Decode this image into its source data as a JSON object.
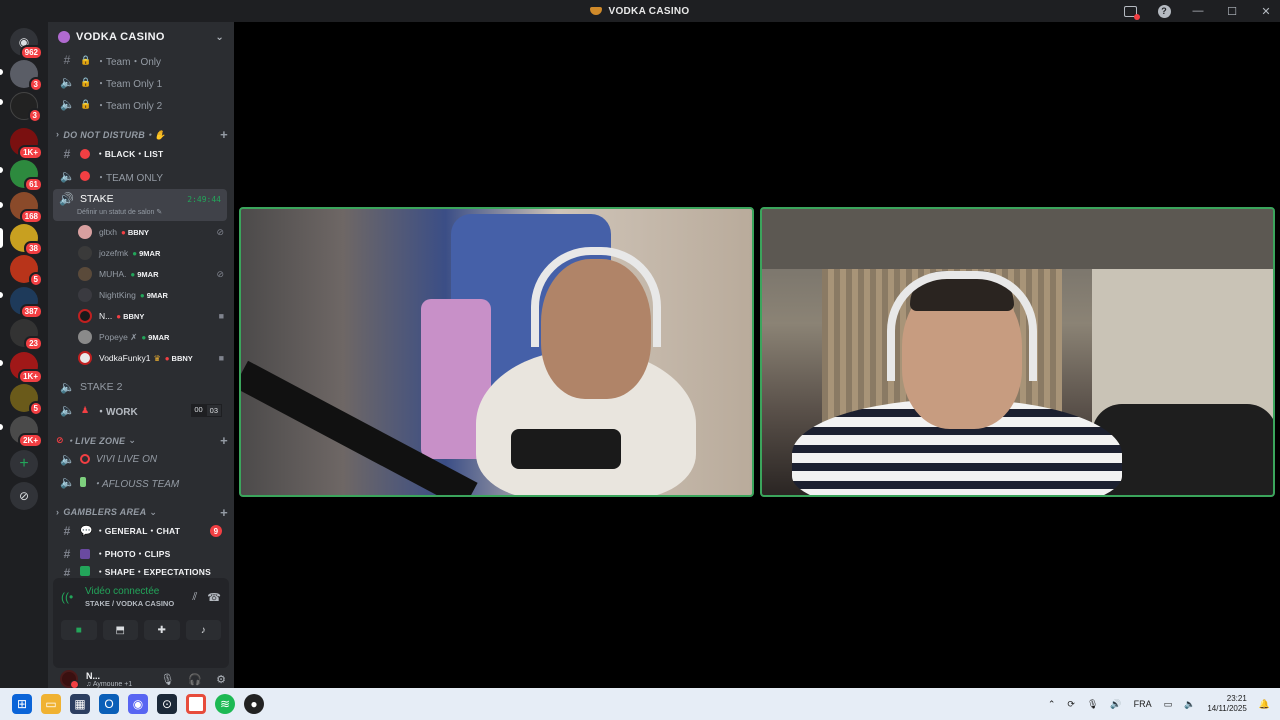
{
  "window": {
    "title": "VODKA CASINO"
  },
  "rail": {
    "badges": [
      "962",
      "3",
      "3",
      "1K+",
      "61",
      "168",
      "38",
      "5",
      "387",
      "23",
      "1K+",
      "5",
      "2K+"
    ]
  },
  "sidebar": {
    "guild_name": "VODKA CASINO",
    "channels_top": [
      {
        "label": "・Team・Only"
      },
      {
        "label": "・Team Only 1"
      },
      {
        "label": "・Team Only 2"
      }
    ],
    "cat_dnd": "DO NOT DISTURB・✋",
    "black_list": "・BLACK・LIST",
    "team_only": "・TEAM ONLY",
    "stake": {
      "name": "STAKE",
      "timer": "2:49:44",
      "status": "Définir un statut de salon"
    },
    "members": [
      {
        "name": "gltxh",
        "tag": "BBNY"
      },
      {
        "name": "jozefmk",
        "tag": "9MAR"
      },
      {
        "name": "MUHA.",
        "tag": "9MAR"
      },
      {
        "name": "NightKing",
        "tag": "9MAR"
      },
      {
        "name": "N...",
        "tag": "BBNY"
      },
      {
        "name": "Popeye ✗",
        "tag": "9MAR"
      },
      {
        "name": "VodkaFunky1",
        "tag": "BBNY"
      }
    ],
    "stake2": "STAKE 2",
    "work": {
      "label": "・WORK",
      "count_a": "00",
      "count_b": "03"
    },
    "cat_live": "・LIVE ZONE",
    "vivi": "VIVI LIVE ON",
    "aflouss": "・AFLOUSS TEAM",
    "cat_gamblers": "GAMBLERS AREA",
    "general": "・GENERAL・CHAT",
    "general_count": "9",
    "photo": "・PHOTO・CLIPS",
    "shape": "・SHAPE・EXPECTATIONS"
  },
  "voice": {
    "status": "Vidéo connectée",
    "location": "STAKE / VODKA CASINO"
  },
  "user": {
    "name": "N...",
    "activity": "Aymoune +1"
  },
  "taskbar": {
    "lang": "FRA",
    "time": "23:21",
    "date": "14/11/2025"
  }
}
